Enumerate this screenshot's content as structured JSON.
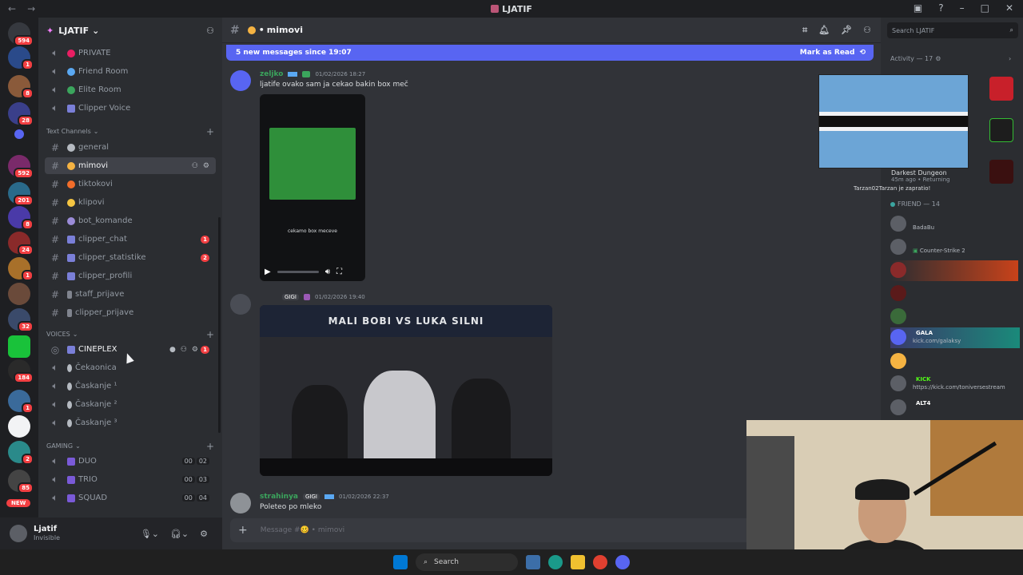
{
  "window": {
    "title": "LJATIF",
    "nav_back": "←",
    "nav_fwd": "→"
  },
  "servers": {
    "badges": [
      "594",
      "1",
      "8",
      "28",
      "592",
      "201",
      "8",
      "24",
      "1",
      "32",
      "184",
      "1",
      "2",
      "85"
    ],
    "new_label": "NEW"
  },
  "guild": {
    "name": "LJATIF"
  },
  "sidebar": {
    "top_channels": [
      "PRIVATE",
      "Friend Room",
      "Elite Room",
      "Clipper Voice"
    ],
    "text_category": "Text Channels",
    "text_channels": [
      {
        "name": "general"
      },
      {
        "name": "mimovi"
      },
      {
        "name": "tiktokovi"
      },
      {
        "name": "klipovi"
      },
      {
        "name": "bot_komande"
      },
      {
        "name": "clipper_chat",
        "badge": "1"
      },
      {
        "name": "clipper_statistike",
        "badge": "2"
      },
      {
        "name": "clipper_profili"
      },
      {
        "name": "staff_prijave"
      },
      {
        "name": "clipper_prijave"
      }
    ],
    "voices_category": "VOICES",
    "voice_channels": [
      {
        "name": "CINEPLEX",
        "badge": "1"
      },
      {
        "name": "Čekaonica"
      },
      {
        "name": "Časkanje ¹"
      },
      {
        "name": "Časkanje ²"
      },
      {
        "name": "Časkanje ³"
      }
    ],
    "gaming_category": "GAMING",
    "gaming_channels": [
      {
        "name": "DUO",
        "count_a": "00",
        "count_b": "02"
      },
      {
        "name": "TRIO",
        "count_a": "00",
        "count_b": "03"
      },
      {
        "name": "SQUAD",
        "count_a": "00",
        "count_b": "04"
      }
    ]
  },
  "user": {
    "name": "Ljatif",
    "status": "Invisible"
  },
  "channel": {
    "name": "mimovi"
  },
  "new_messages": {
    "text": "5 new messages since 19:07",
    "action": "Mark as Read"
  },
  "messages": [
    {
      "author": "zeljko",
      "time": "01/02/2026 18:27",
      "text": "ljatife ovako sam ja cekao bakin box meč",
      "video_caption": "cekamo box meceve"
    },
    {
      "author": "",
      "tag": "GIGI",
      "time": "01/02/2026 19:40",
      "image_banner": "MALI BOBI VS LUKA SILNI"
    },
    {
      "author": "strahinya",
      "tag": "GIGI",
      "time": "01/02/2026 22:37",
      "text": "Poleteo po mleko"
    }
  ],
  "composer": {
    "placeholder": "Message #🥴 • mimovi"
  },
  "right": {
    "search_placeholder": "Search LJATIF",
    "activity_header": "Activity — 17",
    "activity_game": "Darkest Dungeon",
    "activity_meta": "45m ago",
    "activity_status": "Returning",
    "activity_note": "Tarzan02Tarzan je zapratio!",
    "friend_header": "FRIEND — 14",
    "friends": [
      {
        "name": "",
        "status": "BadaBu"
      },
      {
        "name": "",
        "status": "Counter-Strike 2"
      },
      {
        "name": "",
        "status": ""
      },
      {
        "name": "",
        "status": ""
      },
      {
        "name": "",
        "status": ""
      },
      {
        "name": "",
        "tag": "GALA",
        "status": "kick.com/galaksy"
      },
      {
        "name": "",
        "status": ""
      },
      {
        "name": "",
        "tag": "KICK",
        "status": "https://kick.com/toniversestream"
      },
      {
        "name": "",
        "tag": "ALT4",
        "status": ""
      }
    ]
  },
  "taskbar": {
    "search": "Search"
  }
}
